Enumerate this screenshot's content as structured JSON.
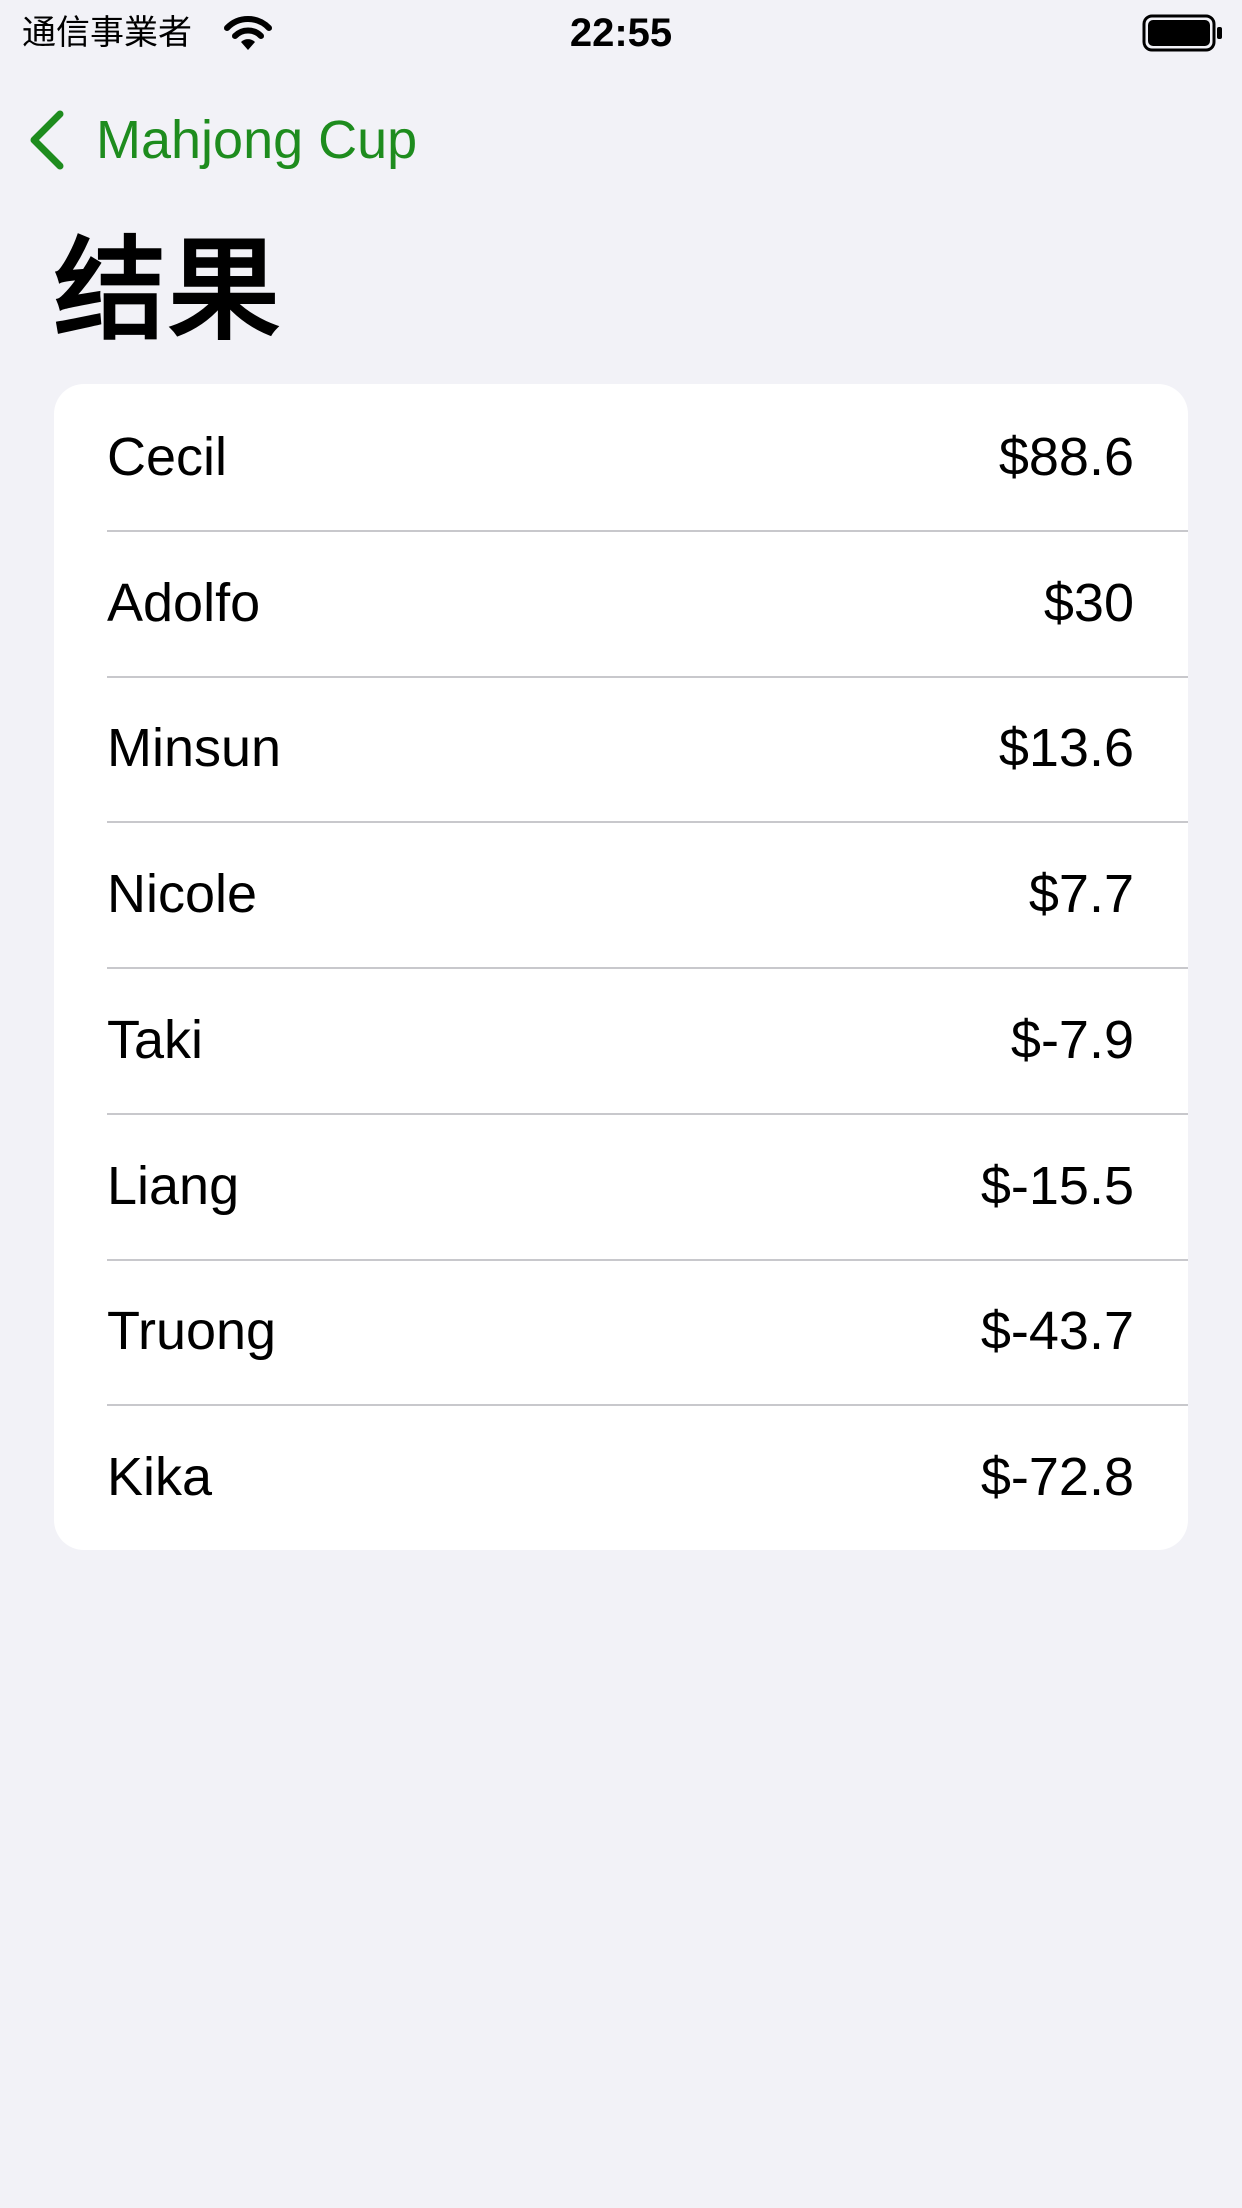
{
  "status_bar": {
    "carrier": "通信事業者",
    "time": "22:55"
  },
  "nav": {
    "back_label": "Mahjong Cup",
    "accent_color": "#1e8c1e"
  },
  "page": {
    "title": "结果"
  },
  "results": [
    {
      "name": "Cecil",
      "amount": "$88.6"
    },
    {
      "name": "Adolfo",
      "amount": "$30"
    },
    {
      "name": "Minsun",
      "amount": "$13.6"
    },
    {
      "name": "Nicole",
      "amount": "$7.7"
    },
    {
      "name": "Taki",
      "amount": "$-7.9"
    },
    {
      "name": "Liang",
      "amount": "$-15.5"
    },
    {
      "name": "Truong",
      "amount": "$-43.7"
    },
    {
      "name": "Kika",
      "amount": "$-72.8"
    }
  ]
}
